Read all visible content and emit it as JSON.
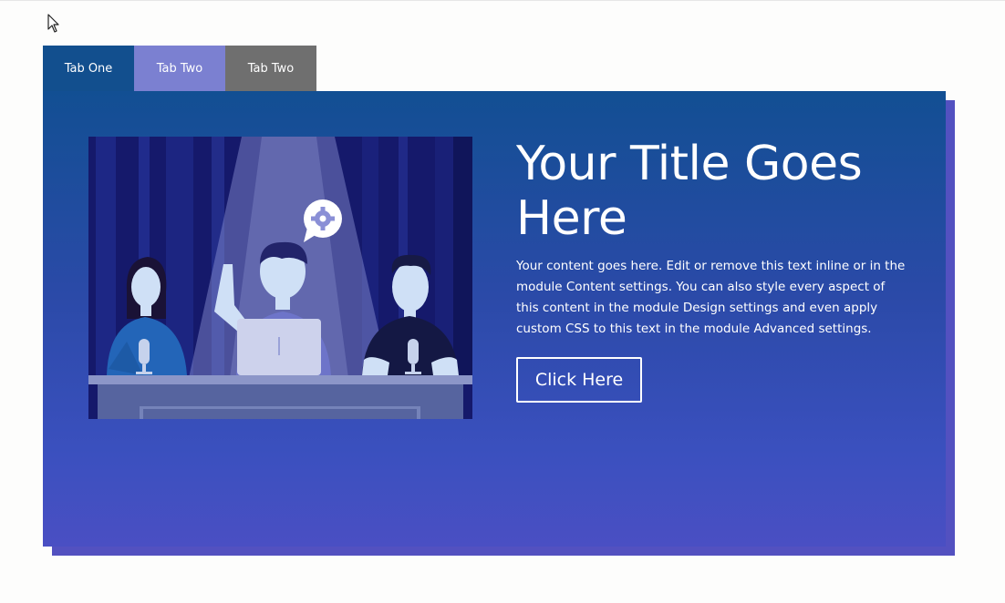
{
  "tabs": [
    {
      "label": "Tab One",
      "color": "#124f8e"
    },
    {
      "label": "Tab Two",
      "color": "#7b80d1"
    },
    {
      "label": "Tab Two",
      "color": "#6f6f6f"
    }
  ],
  "content": {
    "title": "Your Title Goes Here",
    "body": "Your content goes here. Edit or remove this text inline or in the module Content settings. You can also style every aspect of this content in the module Design settings and even apply custom CSS to this text in the module Advanced settings.",
    "button_label": "Click Here"
  },
  "colors": {
    "panel_gradient_top": "#124f93",
    "panel_gradient_bottom": "#4a4fc3",
    "panel_shadow": "#5351c0",
    "text": "#ffffff"
  },
  "icons": {
    "cursor": "mouse-pointer-icon",
    "speech_bubble": "gear-icon"
  }
}
